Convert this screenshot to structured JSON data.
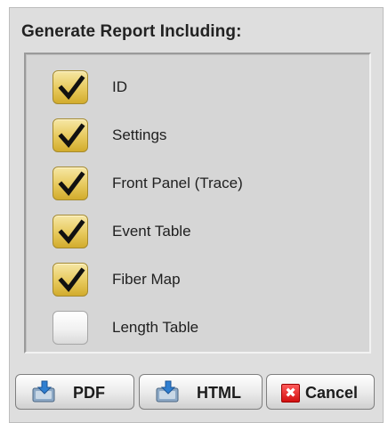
{
  "dialog": {
    "title": "Generate Report Including:"
  },
  "options": [
    {
      "label": "ID",
      "checked": true
    },
    {
      "label": "Settings",
      "checked": true
    },
    {
      "label": "Front Panel (Trace)",
      "checked": true
    },
    {
      "label": "Event Table",
      "checked": true
    },
    {
      "label": "Fiber Map",
      "checked": true
    },
    {
      "label": "Length Table",
      "checked": false
    }
  ],
  "buttons": {
    "pdf_label": "PDF",
    "html_label": "HTML",
    "cancel_label": "Cancel",
    "cancel_icon_glyph": "✖"
  },
  "colors": {
    "checked_fill": "#e7c95c",
    "unchecked_fill": "#f1f1f1",
    "panel_background": "#d6d6d6",
    "dialog_background": "#dedede",
    "cancel_icon": "#d20f0f"
  }
}
